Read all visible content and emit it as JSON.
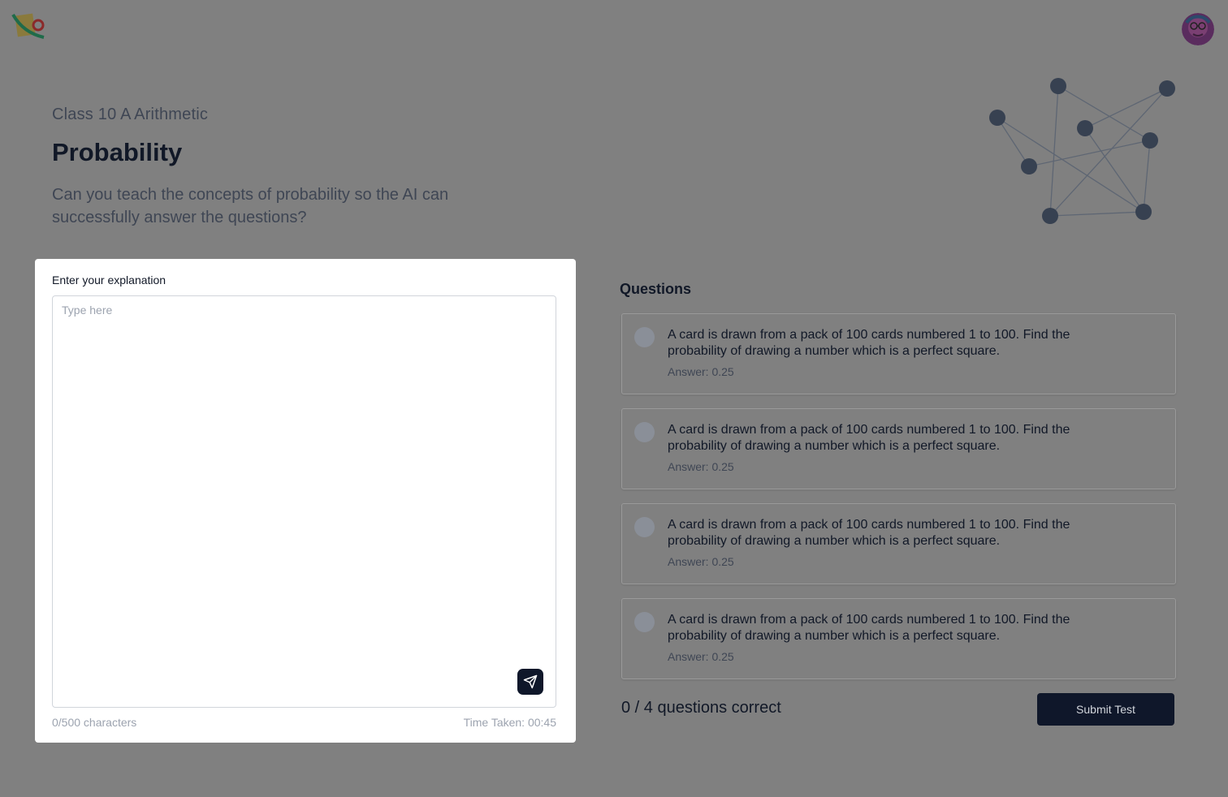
{
  "header": {
    "logo_icon": "app-logo-icon",
    "avatar_icon": "user-avatar-icon"
  },
  "lesson": {
    "class_label": "Class 10 A Arithmetic",
    "title": "Probability",
    "subtitle": "Can you teach the concepts of probability so the AI can successfully answer the questions?"
  },
  "explanation": {
    "label": "Enter your explanation",
    "placeholder": "Type here",
    "value": "",
    "char_count": "0/500 characters",
    "time_taken": "Time Taken: 00:45",
    "send_icon": "send-icon"
  },
  "questions": {
    "heading": "Questions",
    "items": [
      {
        "text": "A card is drawn from a pack of 100 cards numbered 1 to 100. Find the probability of drawing a number which is a perfect square.",
        "answer": "Answer: 0.25"
      },
      {
        "text": "A card is drawn from a pack of 100 cards numbered 1 to 100. Find the probability of drawing a number which is a perfect square.",
        "answer": "Answer: 0.25"
      },
      {
        "text": "A card is drawn from a pack of 100 cards numbered 1 to 100. Find the probability of drawing a number which is a perfect square.",
        "answer": "Answer: 0.25"
      },
      {
        "text": "A card is drawn from a pack of 100 cards numbered 1 to 100. Find the probability of drawing a number which is a perfect square.",
        "answer": "Answer: 0.25"
      }
    ],
    "score": "0 / 4 questions correct",
    "submit_label": "Submit Test"
  },
  "colors": {
    "overlay_background": "#808080",
    "primary_dark": "#0f172a",
    "card_background": "#ffffff",
    "node_color": "#374151"
  }
}
